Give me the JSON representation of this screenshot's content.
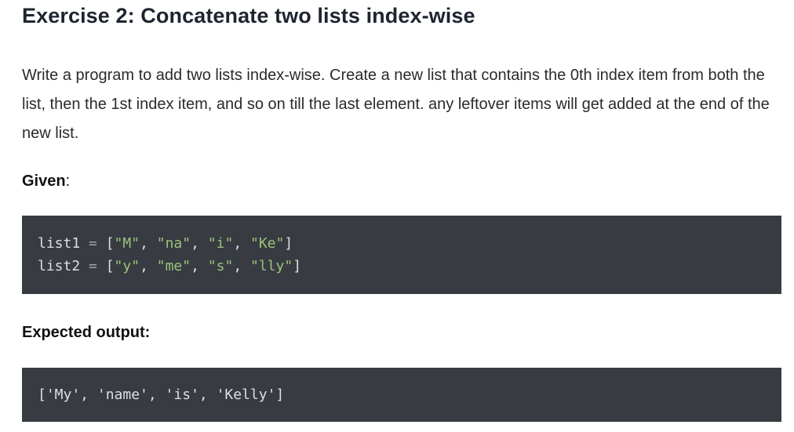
{
  "exercise": {
    "title": "Exercise 2: Concatenate two lists index-wise",
    "description": "Write a program to add two lists index-wise. Create a new list that contains the 0th index item from both the list, then the 1st index item, and so on till the last element. any leftover items will get added at the end of the new list.",
    "given_label": "Given",
    "given_suffix": ":",
    "given_code": {
      "line1": {
        "var": "list1",
        "op": " = ",
        "open": "[",
        "items": [
          "\"M\"",
          "\"na\"",
          "\"i\"",
          "\"Ke\""
        ],
        "close": "]"
      },
      "line2": {
        "var": "list2",
        "op": " = ",
        "open": "[",
        "items": [
          "\"y\"",
          "\"me\"",
          "\"s\"",
          "\"lly\""
        ],
        "close": "]"
      }
    },
    "expected_label": "Expected output:",
    "expected_output": "['My', 'name', 'is', 'Kelly']"
  },
  "colors": {
    "code_background": "#383b42",
    "string": "#98c379",
    "heading": "#1e2430"
  }
}
